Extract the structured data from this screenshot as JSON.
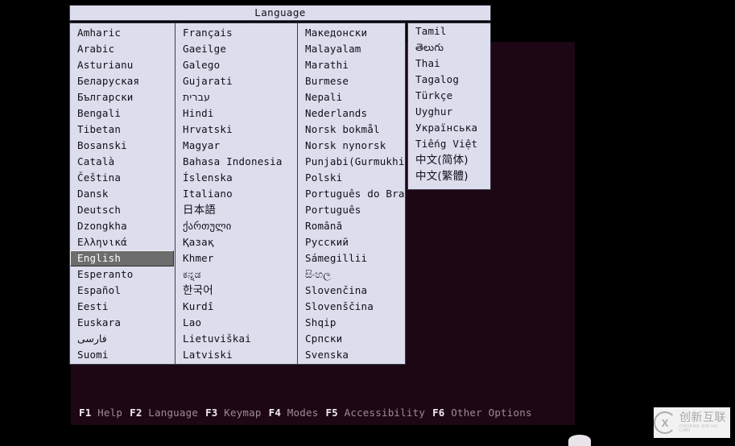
{
  "screen": {
    "background_color": "#000000",
    "console_background_color": "#1d0714"
  },
  "dialog": {
    "title": "Language",
    "title_background": "#dcdeee",
    "list_background": "#dcdeee",
    "selection_background": "#6d6d6d",
    "selection_text_color": "#ffffff",
    "columns": [
      {
        "name": "column-1",
        "items": [
          "Amharic",
          "Arabic",
          "Asturianu",
          "Беларуская",
          "Български",
          "Bengali",
          "Tibetan",
          "Bosanski",
          "Català",
          "Čeština",
          "Dansk",
          "Deutsch",
          "Dzongkha",
          "Ελληνικά",
          "English",
          "Esperanto",
          "Español",
          "Eesti",
          "Euskara",
          "فارسی",
          "Suomi"
        ],
        "selected": "English",
        "selected_index": 14
      },
      {
        "name": "column-2",
        "items": [
          "Français",
          "Gaeilge",
          "Galego",
          "Gujarati",
          "עברית",
          "Hindi",
          "Hrvatski",
          "Magyar",
          "Bahasa Indonesia",
          "Íslenska",
          "Italiano",
          "日本語",
          "ქართული",
          "Қазақ",
          "Khmer",
          "ಕನ್ನಡ",
          "한국어",
          "Kurdî",
          "Lao",
          "Lietuviškai",
          "Latviski"
        ]
      },
      {
        "name": "column-3",
        "items": [
          "Македонски",
          "Malayalam",
          "Marathi",
          "Burmese",
          "Nepali",
          "Nederlands",
          "Norsk bokmål",
          "Norsk nynorsk",
          "Punjabi(Gurmukhi)",
          "Polski",
          "Português do Brasil",
          "Português",
          "Română",
          "Русский",
          "Sámegillii",
          "සිංහල",
          "Slovenčina",
          "Slovenščina",
          "Shqip",
          "Српски",
          "Svenska"
        ]
      },
      {
        "name": "column-4",
        "items": [
          "Tamil",
          "తెలుగు",
          "Thai",
          "Tagalog",
          "Türkçe",
          "Uyghur",
          "Українська",
          "Tiếng Việt",
          "中文(简体)",
          "中文(繁體)"
        ]
      }
    ]
  },
  "function_bar": {
    "keys": [
      {
        "key": "F1",
        "label": "Help"
      },
      {
        "key": "F2",
        "label": "Language"
      },
      {
        "key": "F3",
        "label": "Keymap"
      },
      {
        "key": "F4",
        "label": "Modes"
      },
      {
        "key": "F5",
        "label": "Accessibility"
      },
      {
        "key": "F6",
        "label": "Other Options"
      }
    ],
    "key_color": "#f2eaf0",
    "label_color": "#9c8b95"
  },
  "watermark": {
    "chinese": "创新互联",
    "pinyin": "CHUANG XIN HU LIAN"
  }
}
